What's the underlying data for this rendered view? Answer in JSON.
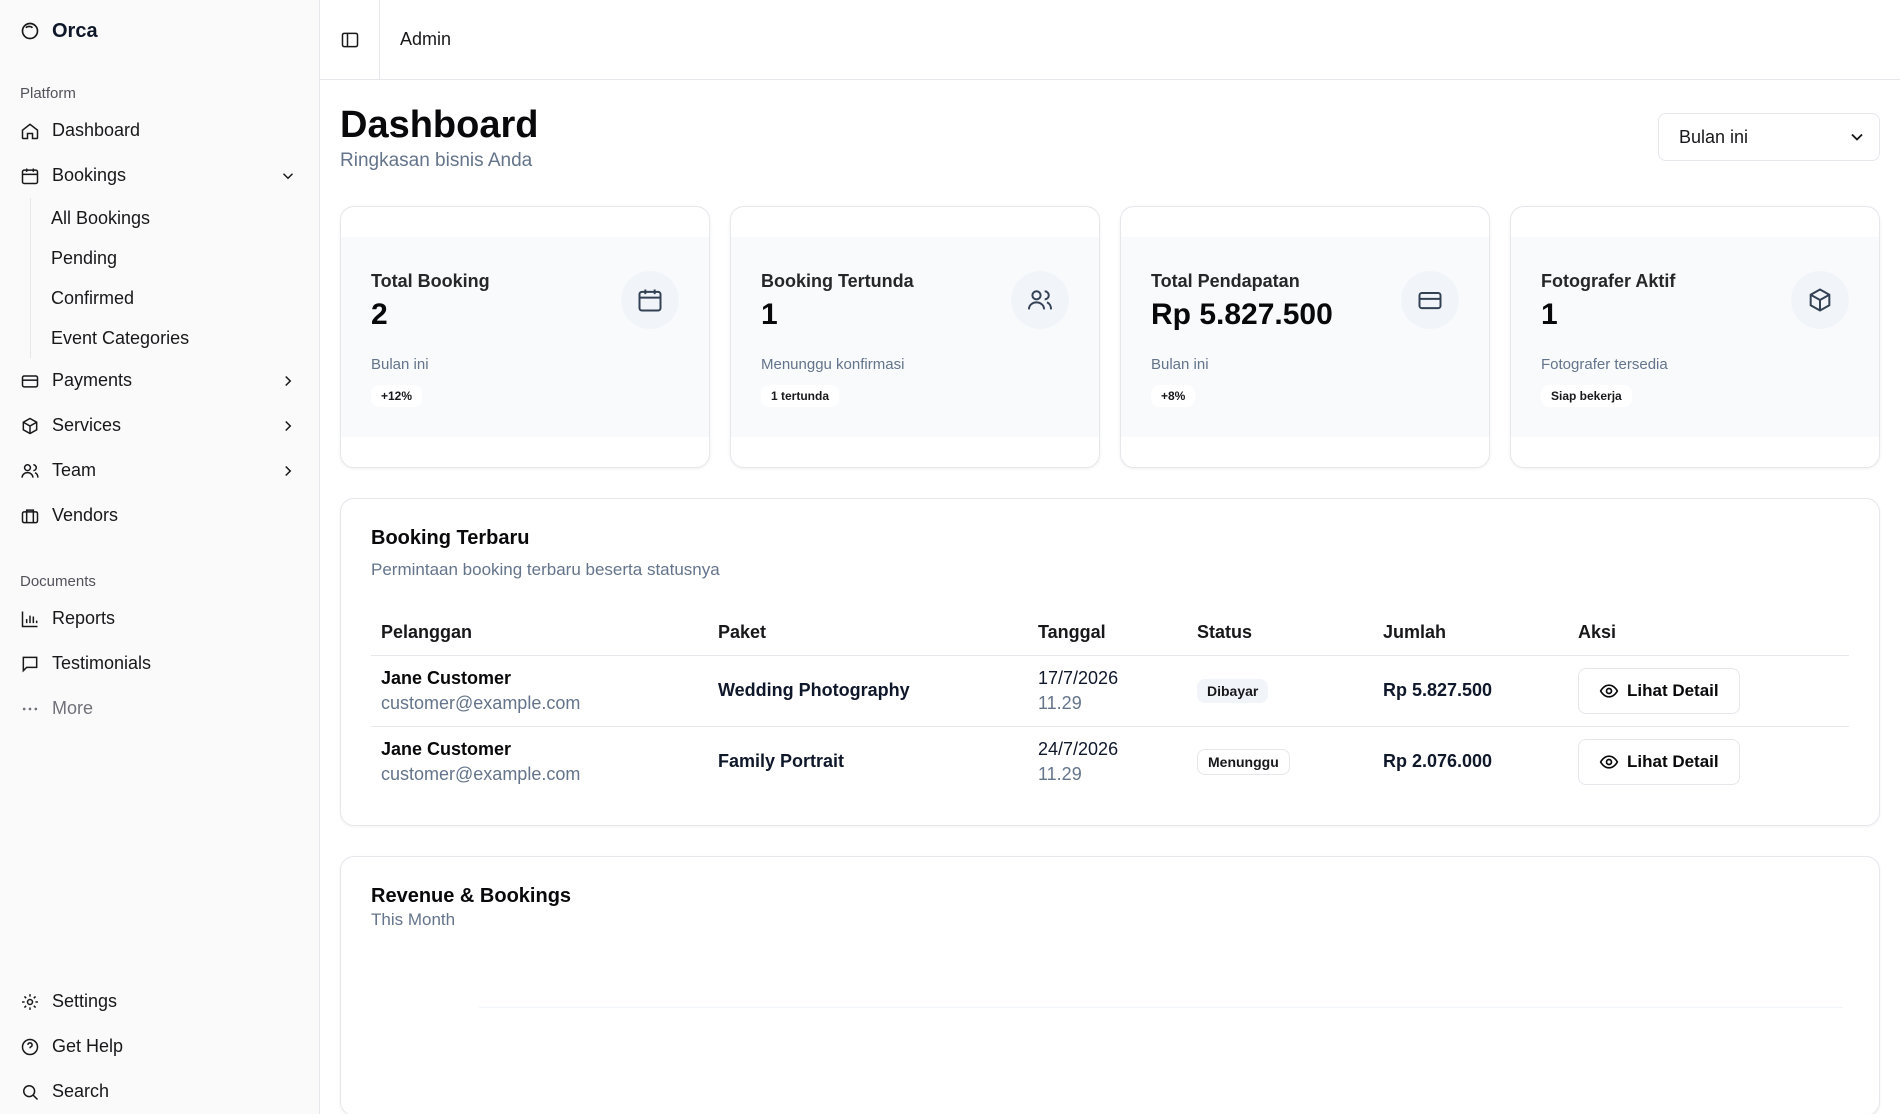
{
  "sidebar": {
    "brand": "Orca",
    "platform_label": "Platform",
    "nav": {
      "dashboard": "Dashboard",
      "bookings": "Bookings",
      "all_bookings": "All Bookings",
      "pending": "Pending",
      "confirmed": "Confirmed",
      "event_categories": "Event Categories",
      "payments": "Payments",
      "services": "Services",
      "team": "Team",
      "vendors": "Vendors"
    },
    "documents_label": "Documents",
    "docs": {
      "reports": "Reports",
      "testimonials": "Testimonials",
      "more": "More"
    },
    "bottom": {
      "settings": "Settings",
      "help": "Get Help",
      "search": "Search"
    }
  },
  "topbar": {
    "breadcrumb": "Admin"
  },
  "header": {
    "title": "Dashboard",
    "subtitle": "Ringkasan bisnis Anda",
    "period_select": "Bulan ini"
  },
  "cards": [
    {
      "label": "Total Booking",
      "value": "2",
      "note": "Bulan ini",
      "badge": "+12%",
      "icon": "calendar-icon"
    },
    {
      "label": "Booking Tertunda",
      "value": "1",
      "note": "Menunggu konfirmasi",
      "badge": "1 tertunda",
      "icon": "users-icon"
    },
    {
      "label": "Total Pendapatan",
      "value": "Rp 5.827.500",
      "note": "Bulan ini",
      "badge": "+8%",
      "icon": "credit-card-icon"
    },
    {
      "label": "Fotografer Aktif",
      "value": "1",
      "note": "Fotografer tersedia",
      "badge": "Siap bekerja",
      "icon": "package-icon"
    }
  ],
  "recent": {
    "title": "Booking Terbaru",
    "subtitle": "Permintaan booking terbaru beserta statusnya",
    "columns": [
      "Pelanggan",
      "Paket",
      "Tanggal",
      "Status",
      "Jumlah",
      "Aksi"
    ],
    "rows": [
      {
        "name": "Jane Customer",
        "email": "customer@example.com",
        "package": "Wedding Photography",
        "date": "17/7/2026",
        "time": "11.29",
        "status": "Dibayar",
        "amount": "Rp 5.827.500",
        "action": "Lihat Detail"
      },
      {
        "name": "Jane Customer",
        "email": "customer@example.com",
        "package": "Family Portrait",
        "date": "24/7/2026",
        "time": "11.29",
        "status": "Menunggu",
        "amount": "Rp 2.076.000",
        "action": "Lihat Detail"
      }
    ]
  },
  "chart": {
    "title": "Revenue & Bookings",
    "subtitle": "This Month"
  },
  "colors": {
    "accent": "#09090b",
    "muted_text": "#64748b",
    "border": "#e5e7eb",
    "card_inner_bg": "#f8fafc"
  }
}
